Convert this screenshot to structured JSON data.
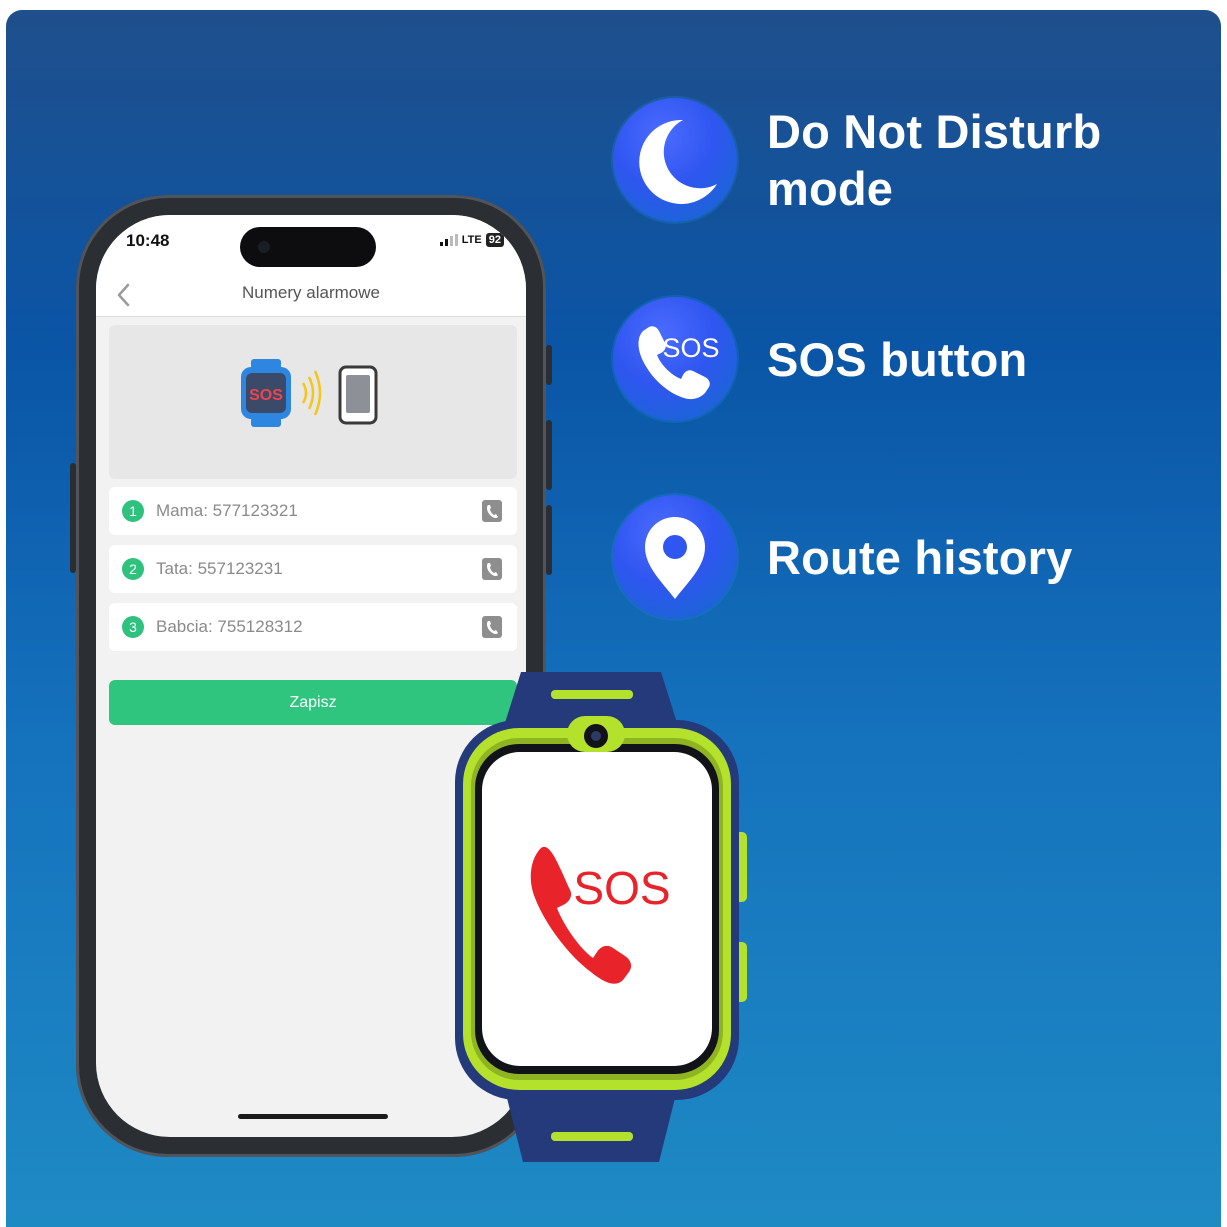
{
  "features": [
    {
      "icon": "moon-icon",
      "line1": "Do Not Disturb",
      "line2": "mode"
    },
    {
      "icon": "sos-phone-icon",
      "icon_text": "SOS",
      "line1": "SOS button"
    },
    {
      "icon": "location-pin-icon",
      "line1": "Route history"
    }
  ],
  "phone": {
    "status": {
      "time": "10:48",
      "network": "LTE",
      "battery": "92"
    },
    "title": "Numery alarmowe",
    "illustration": {
      "watch_text": "SOS"
    },
    "contacts": [
      {
        "index": "1",
        "text": "Mama: 577123321"
      },
      {
        "index": "2",
        "text": "Tata: 557123231"
      },
      {
        "index": "3",
        "text": "Babcia: 755128312"
      }
    ],
    "save_label": "Zapisz"
  },
  "watch": {
    "screen_text": "SOS"
  },
  "colors": {
    "background_top": "#1f4f8c",
    "background_bottom": "#1e8ac4",
    "accent_green": "#2fc57f",
    "watch_lime": "#b4e12b",
    "watch_navy": "#243a7a",
    "sos_red": "#e8232a"
  }
}
